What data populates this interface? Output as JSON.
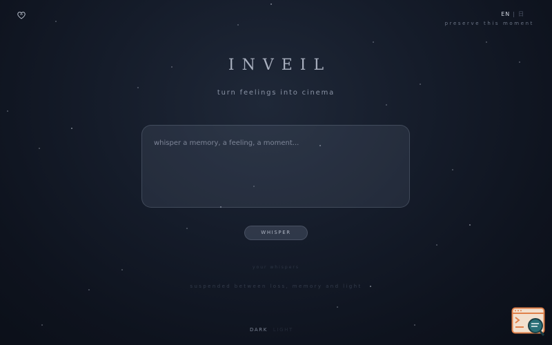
{
  "header": {
    "lang_active": "EN",
    "lang_separator": "|",
    "lang_other": "日",
    "tagline": "preserve this moment"
  },
  "hero": {
    "title": "INVEIL",
    "subtitle": "turn feelings into cinema"
  },
  "composer": {
    "placeholder": "whisper a memory, a feeling, a moment...",
    "value": "",
    "submit_label": "WHISPER"
  },
  "footer": {
    "faint_link": "your whispers",
    "line": "suspended between loss, memory and light",
    "theme_active": "DARK",
    "theme_other": "LIGHT"
  },
  "icons": {
    "logo": "heart-outline-icon",
    "corner_widget": "terminal-search-icon"
  },
  "colors": {
    "background": "#151c2a",
    "accent_widget": "#e0804a",
    "text_primary": "#c9cfdb"
  }
}
